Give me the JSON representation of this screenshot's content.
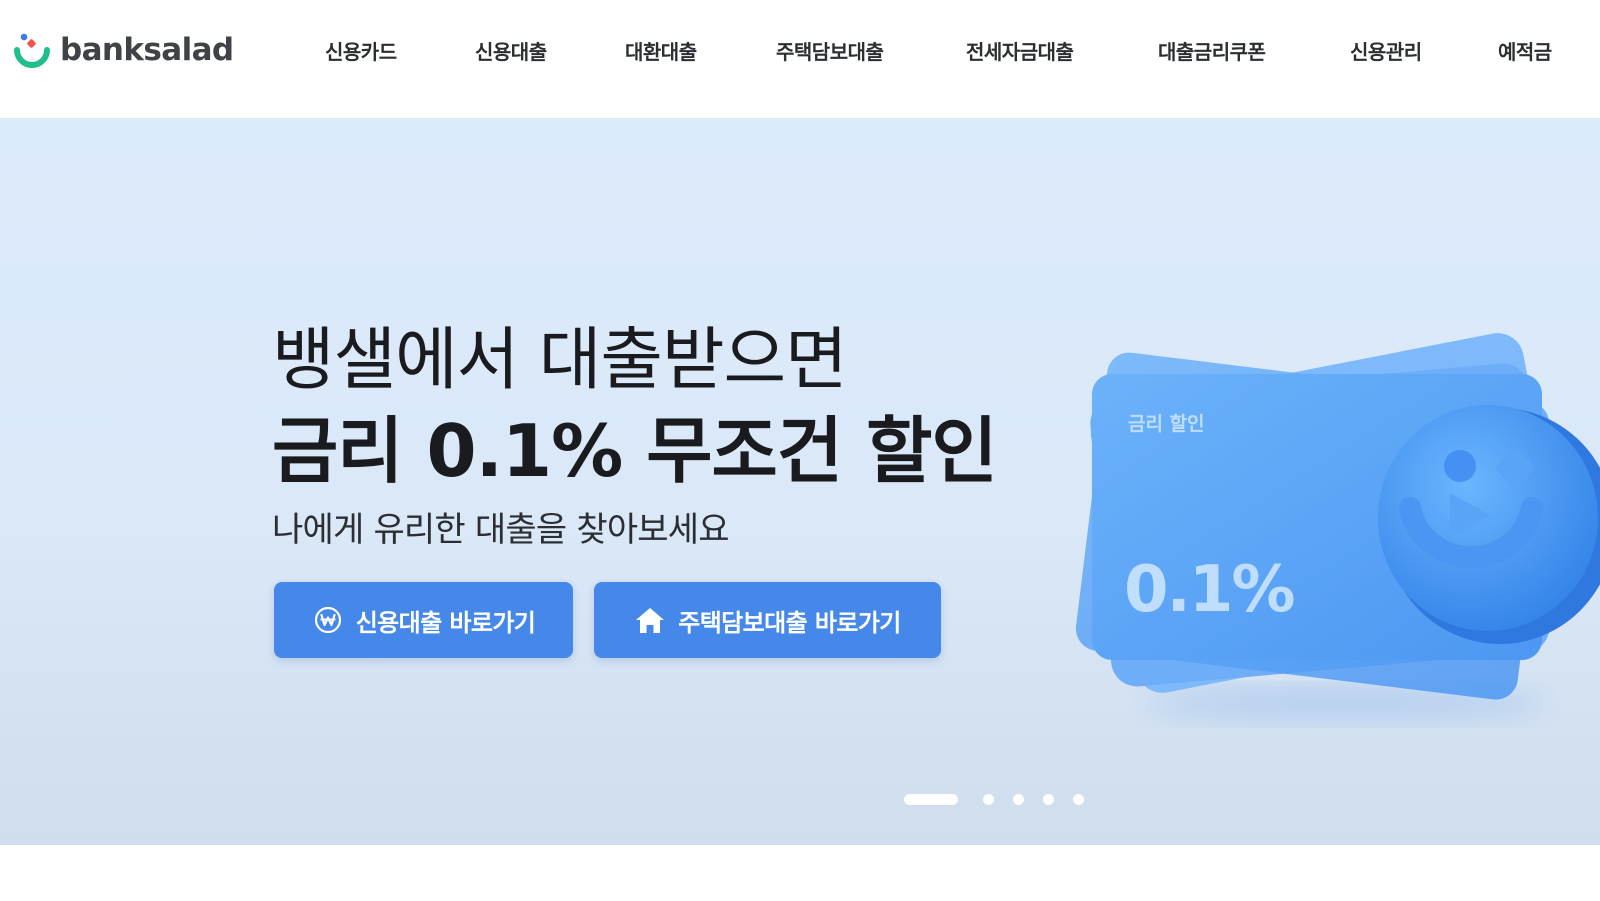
{
  "header": {
    "logo_text": "banksalad",
    "nav": [
      {
        "label": "신용카드"
      },
      {
        "label": "신용대출"
      },
      {
        "label": "대환대출"
      },
      {
        "label": "주택담보대출"
      },
      {
        "label": "전세자금대출"
      },
      {
        "label": "대출금리쿠폰"
      },
      {
        "label": "신용관리"
      },
      {
        "label": "예적금"
      }
    ]
  },
  "hero": {
    "headline_line1": "뱅샐에서 대출받으면",
    "headline_line2": "금리 0.1% 무조건 할인",
    "subtitle": "나에게 유리한 대출을 찾아보세요",
    "buttons": {
      "credit_loan": {
        "label": "신용대출 바로가기",
        "icon": "won-coin-icon"
      },
      "mortgage_loan": {
        "label": "주택담보대출 바로가기",
        "icon": "house-icon"
      }
    },
    "card": {
      "label": "금리 할인",
      "value": "0.1%"
    },
    "pagination": {
      "total": 5,
      "active": 1
    }
  },
  "colors": {
    "accent_button": "#4688ea",
    "hero_background": "#dcebfb",
    "card_blue": "#5ea6f7",
    "logo_green": "#1fbf8a",
    "logo_blue": "#3c7cf0",
    "logo_red": "#f5544e"
  }
}
